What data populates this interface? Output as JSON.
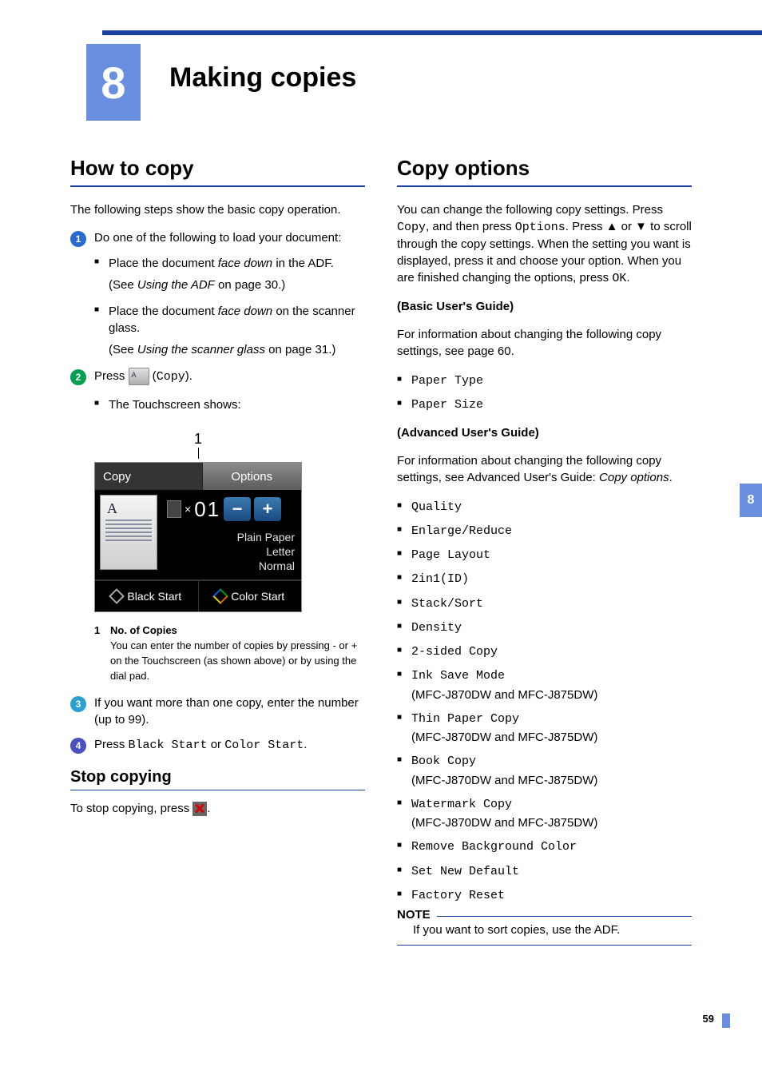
{
  "chapter": {
    "number": "8",
    "title": "Making copies"
  },
  "sideTab": "8",
  "pageNumber": "59",
  "left": {
    "h_howto": "How to copy",
    "intro": "The following steps show the basic copy operation.",
    "step1": "Do one of the following to load your document:",
    "s1b1a": "Place the document ",
    "s1b1b": "face down",
    "s1b1c": " in the ADF.",
    "s1n1a": "(See ",
    "s1n1b": "Using the ADF",
    "s1n1c": " on page 30.)",
    "s1b2a": "Place the document ",
    "s1b2b": "face down",
    "s1b2c": " on the scanner glass.",
    "s1n2a": "(See ",
    "s1n2b": "Using the scanner glass",
    "s1n2c": " on page 31.)",
    "step2a": "Press ",
    "step2b": " (",
    "step2c": "Copy",
    "step2d": ").",
    "s2b1": "The Touchscreen shows:",
    "ts": {
      "callout": "1",
      "copy": "Copy",
      "options": "Options",
      "qtyPrefix": "×",
      "qty": "01",
      "minus": "−",
      "plus": "+",
      "info1": "Plain Paper",
      "info2": "Letter",
      "info3": "Normal",
      "black": "Black Start",
      "color": "Color Start"
    },
    "cap_num": "1",
    "cap_title": "No. of Copies",
    "cap_body": "You can enter the number of copies by pressing - or + on the Touchscreen (as shown above) or by using the dial pad.",
    "step3": "If you want more than one copy, enter the number (up to 99).",
    "step4a": "Press ",
    "step4b": "Black Start",
    "step4c": " or ",
    "step4d": "Color Start",
    "step4e": ".",
    "h_stop": "Stop copying",
    "stop_a": "To stop copying, press ",
    "stop_b": "."
  },
  "right": {
    "h_opts": "Copy options",
    "p1a": "You can change the following copy settings. Press ",
    "p1b": "Copy",
    "p1c": ", and then press ",
    "p1d": "Options",
    "p1e": ". Press ▲ or ▼ to scroll through the copy settings. When the setting you want is displayed, press it and choose your option. When you are finished changing the options, press ",
    "p1f": "OK",
    "p1g": ".",
    "basic_h": "(Basic User's Guide)",
    "basic_p": "For information about changing the following copy settings, see page 60.",
    "b1": "Paper Type",
    "b2": "Paper Size",
    "adv_h": "(Advanced User's Guide)",
    "adv_p1": "For information about changing the following copy settings, see Advanced User's Guide: ",
    "adv_p2": "Copy options",
    "adv_p3": ".",
    "a1": "Quality",
    "a2": "Enlarge/Reduce",
    "a3": "Page Layout",
    "a4": "2in1(ID)",
    "a5": "Stack/Sort",
    "a6": "Density",
    "a7": "2-sided Copy",
    "a8": "Ink Save Mode",
    "a8n": "(MFC-J870DW and MFC-J875DW)",
    "a9": "Thin Paper Copy",
    "a9n": "(MFC-J870DW and MFC-J875DW)",
    "a10": "Book Copy",
    "a10n": "(MFC-J870DW and MFC-J875DW)",
    "a11": "Watermark Copy",
    "a11n": "(MFC-J870DW and MFC-J875DW)",
    "a12": "Remove Background Color",
    "a13": "Set New Default",
    "a14": "Factory Reset",
    "note_label": "NOTE",
    "note_text": "If you want to sort copies, use the ADF."
  }
}
